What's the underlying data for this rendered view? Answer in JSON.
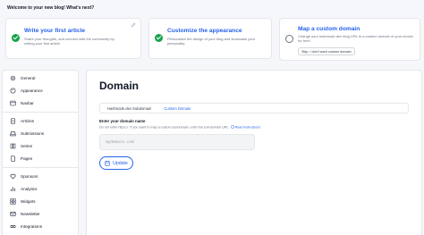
{
  "welcome": "Welcome to your new blog! What's next?",
  "cards": [
    {
      "title": "Write your first article",
      "description": "Share your thoughts, and connect with the community by writing your first article.",
      "done": true
    },
    {
      "title": "Customize the appearance",
      "description": "Personalize the design of your blog and showcase your personality.",
      "done": true
    },
    {
      "title": "Map a custom domain",
      "description": "Change your hashnode.dev blog URL to a custom domain of your choice for free!",
      "done": false,
      "skip_label": "Skip, I don't want custom domain"
    }
  ],
  "sidebar": {
    "items": [
      {
        "label": "General",
        "icon": "gear-icon"
      },
      {
        "label": "Appearance",
        "icon": "palette-icon"
      },
      {
        "label": "Navbar",
        "icon": "navbar-icon"
      },
      {
        "label": "Articles",
        "icon": "document-icon"
      },
      {
        "label": "Submissions",
        "icon": "inbox-icon"
      },
      {
        "label": "Series",
        "icon": "series-icon"
      },
      {
        "label": "Pages",
        "icon": "pages-icon"
      },
      {
        "label": "Sponsors",
        "icon": "heart-icon"
      },
      {
        "label": "Analytics",
        "icon": "chart-icon"
      },
      {
        "label": "Widgets",
        "icon": "widgets-icon"
      },
      {
        "label": "Newsletter",
        "icon": "mail-icon"
      },
      {
        "label": "Integrations",
        "icon": "integrations-icon"
      }
    ]
  },
  "main": {
    "title": "Domain",
    "tabs": [
      {
        "label": "Hashnode.dev Subdomain",
        "active": false
      },
      {
        "label": "Custom Domain",
        "active": true
      }
    ],
    "field_label": "Enter your domain name",
    "help_text": "Do not enter https://. If you want to map a custom subdomain, enter full sub-domain URL.",
    "help_link": "Read instructions",
    "input_placeholder": "mydomain.com",
    "update_label": "Update"
  },
  "colors": {
    "accent": "#2563eb",
    "success": "#16a34a"
  }
}
